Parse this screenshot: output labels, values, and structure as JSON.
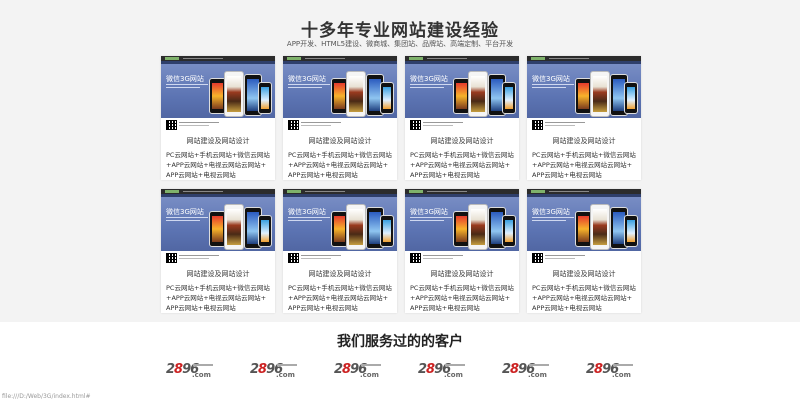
{
  "hero": {
    "title": "十多年专业网站建设经验",
    "subtitle": "APP开发、HTML5建设、微商城、集团站、品牌站、高端定制、平台开发"
  },
  "cards": [
    {
      "thumb_heading": "微信3G网站",
      "title": "网站建设及网站设计",
      "desc": "PC云网站+手机云网站+微信云网站+APP云网站+电视云网站云网站+APP云网站+电视云网站"
    },
    {
      "thumb_heading": "微信3G网站",
      "title": "网站建设及网站设计",
      "desc": "PC云网站+手机云网站+微信云网站+APP云网站+电视云网站云网站+APP云网站+电视云网站"
    },
    {
      "thumb_heading": "微信3G网站",
      "title": "网站建设及网站设计",
      "desc": "PC云网站+手机云网站+微信云网站+APP云网站+电视云网站云网站+APP云网站+电视云网站"
    },
    {
      "thumb_heading": "微信3G网站",
      "title": "网站建设及网站设计",
      "desc": "PC云网站+手机云网站+微信云网站+APP云网站+电视云网站云网站+APP云网站+电视云网站"
    },
    {
      "thumb_heading": "微信3G网站",
      "title": "网站建设及网站设计",
      "desc": "PC云网站+手机云网站+微信云网站+APP云网站+电视云网站云网站+APP云网站+电视云网站"
    },
    {
      "thumb_heading": "微信3G网站",
      "title": "网站建设及网站设计",
      "desc": "PC云网站+手机云网站+微信云网站+APP云网站+电视云网站云网站+APP云网站+电视云网站"
    },
    {
      "thumb_heading": "微信3G网站",
      "title": "网站建设及网站设计",
      "desc": "PC云网站+手机云网站+微信云网站+APP云网站+电视云网站云网站+APP云网站+电视云网站"
    },
    {
      "thumb_heading": "微信3G网站",
      "title": "网站建设及网站设计",
      "desc": "PC云网站+手机云网站+微信云网站+APP云网站+电视云网站云网站+APP云网站+电视云网站"
    }
  ],
  "clients": {
    "title": "我们服务过的的客户",
    "logos": [
      {
        "number": "2896",
        "suffix": ".com"
      },
      {
        "number": "2896",
        "suffix": ".com"
      },
      {
        "number": "2896",
        "suffix": ".com"
      },
      {
        "number": "2896",
        "suffix": ".com"
      },
      {
        "number": "2896",
        "suffix": ".com"
      },
      {
        "number": "2896",
        "suffix": ".com"
      }
    ]
  },
  "status_bar": {
    "url": "file:///D:/Web/3G/index.html#"
  },
  "colors": {
    "background": "#f3f3f3",
    "card": "#ffffff",
    "thumb_blue": "#5c74b3",
    "logo_accent": "#cc2222"
  }
}
